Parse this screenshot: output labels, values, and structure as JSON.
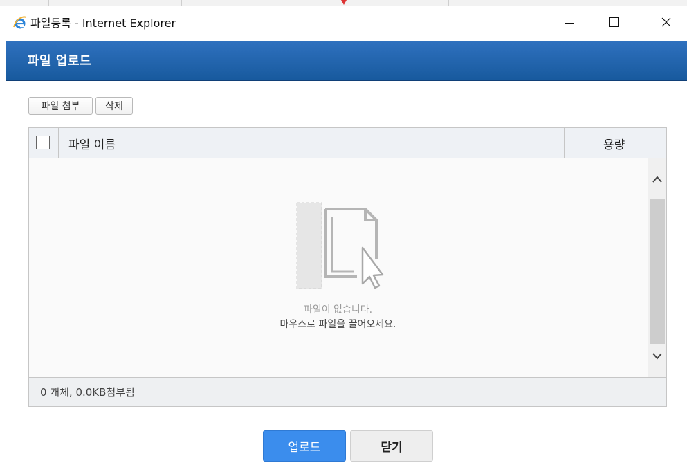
{
  "window": {
    "title": "파일등록 - Internet Explorer",
    "icon": "internet-explorer-icon"
  },
  "header": {
    "title": "파일 업로드",
    "accent_color": "#2566b0"
  },
  "toolbar": {
    "attach_label": "파일 첨부",
    "delete_label": "삭제"
  },
  "table": {
    "columns": [
      "파일 이름",
      "용량"
    ],
    "rows": [],
    "empty_message_1": "파일이 없습니다.",
    "empty_message_2": "마우스로 파일을 끌어오세요.",
    "footer": "0 개체, 0.0KB첨부됨"
  },
  "actions": {
    "upload_label": "업로드",
    "close_label": "닫기",
    "upload_color": "#3b8ded"
  }
}
